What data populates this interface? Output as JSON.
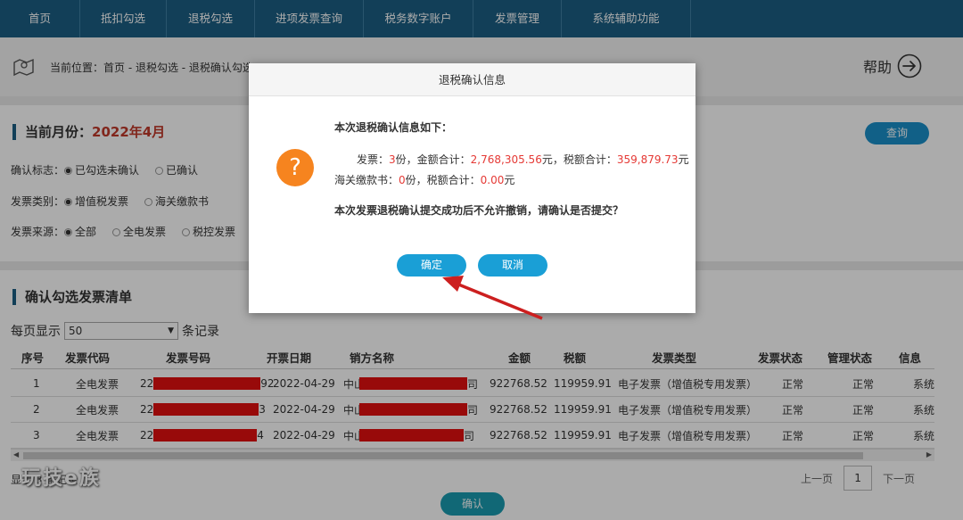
{
  "nav": {
    "items": [
      {
        "label": "首页",
        "w": 90
      },
      {
        "label": "抵扣勾选",
        "w": 97
      },
      {
        "label": "退税勾选",
        "w": 99
      },
      {
        "label": "进项发票查询",
        "w": 122
      },
      {
        "label": "税务数字账户",
        "w": 123
      },
      {
        "label": "发票管理",
        "w": 99
      },
      {
        "label": "系统辅助功能",
        "w": 145
      }
    ]
  },
  "breadcrumb": {
    "icon": "map-icon",
    "text": "当前位置：首页 - 退税勾选 - 退税确认勾选"
  },
  "help": {
    "label": "帮助",
    "icon": "arrow-right-circle-icon"
  },
  "filter": {
    "month_label": "当前月份：",
    "month_value": "2022年4月",
    "query_label": "查询",
    "rows": [
      {
        "label": "确认标志：",
        "options": [
          "已勾选未确认",
          "已确认"
        ],
        "selected": 0
      },
      {
        "label": "发票类别：",
        "options": [
          "增值税发票",
          "海关缴款书"
        ],
        "selected": 0
      },
      {
        "label": "发票来源：",
        "options": [
          "全部",
          "全电发票",
          "税控发票"
        ],
        "selected": 0
      }
    ]
  },
  "list": {
    "title": "确认勾选发票清单",
    "perpage_prefix": "每页显示",
    "perpage_value": "50",
    "perpage_suffix": "条记录",
    "columns": [
      "序号",
      "发票代码",
      "发票号码",
      "开票日期",
      "销方名称",
      "金额",
      "税额",
      "发票类型",
      "发票状态",
      "管理状态",
      "信息"
    ],
    "rows": [
      {
        "no": "1",
        "code": "全电发票",
        "num_pre": "22",
        "num_post": "92",
        "date": "2022-04-29",
        "seller_pre": "中山",
        "seller_post": "司",
        "amount": "922768.52",
        "tax": "119959.91",
        "type": "电子发票（增值税专用发票）",
        "status": "正常",
        "mgmt": "正常",
        "info": "系统"
      },
      {
        "no": "2",
        "code": "全电发票",
        "num_pre": "22",
        "num_post": "3",
        "date": "2022-04-29",
        "seller_pre": "中山",
        "seller_post": "司",
        "amount": "922768.52",
        "tax": "119959.91",
        "type": "电子发票（增值税专用发票）",
        "status": "正常",
        "mgmt": "正常",
        "info": "系统"
      },
      {
        "no": "3",
        "code": "全电发票",
        "num_pre": "22",
        "num_post": "4",
        "date": "2022-04-29",
        "seller_pre": "中山",
        "seller_post": "司",
        "amount": "922768.52",
        "tax": "119959.91",
        "type": "电子发票（增值税专用发票）",
        "status": "正常",
        "mgmt": "正常",
        "info": "系统"
      }
    ],
    "total_text": "显示 3 条记录",
    "pager": {
      "prev": "上一页",
      "page": "1",
      "next": "下一页"
    },
    "confirm_label": "确认"
  },
  "watermark": "玩技e族",
  "modal": {
    "title": "退税确认信息",
    "heading": "本次退税确认信息如下：",
    "invoice_prefix": "发票：",
    "invoice_count": "3",
    "invoice_mid": "份，金额合计：",
    "invoice_amount": "2,768,305.56",
    "invoice_mid2": "元，税额合计：",
    "invoice_tax": "359,879.73",
    "invoice_suffix": "元",
    "customs_prefix": "海关缴款书：",
    "customs_count": "0",
    "customs_mid": "份，税额合计：",
    "customs_tax": "0.00",
    "customs_suffix": "元",
    "warning": "本次发票退税确认提交成功后不允许撤销，请确认是否提交？",
    "ok_label": "确定",
    "cancel_label": "取消",
    "icon": "question-icon"
  },
  "colors": {
    "nav_bg": "#1c5f84",
    "accent": "#1a9fd6",
    "value_red": "#e53935",
    "redaction": "#e31010",
    "arrow": "#cc1f1f",
    "question_orange": "#f6841f"
  }
}
